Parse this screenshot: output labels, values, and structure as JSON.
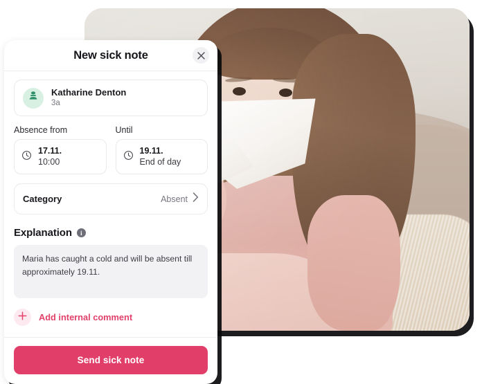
{
  "photo": {
    "alt_description": "Young girl with long brown hair holding a white tissue to her nose, sitting on a beige sofa with a fluffy rug",
    "name": "sick-child-photo"
  },
  "modal": {
    "title": "New sick note",
    "close_label": "×",
    "close_icon": "close-icon",
    "person": {
      "avatar_icon": "person-avatar-icon",
      "name": "Katharine Denton",
      "group": "3a"
    },
    "absence_from": {
      "label": "Absence from",
      "icon": "clock-icon",
      "date": "17.11.",
      "time": "10:00"
    },
    "until": {
      "label": "Until",
      "icon": "clock-icon",
      "date": "19.11.",
      "time": "End of day"
    },
    "category": {
      "label": "Category",
      "value": "Absent",
      "chevron_icon": "chevron-right-icon"
    },
    "explanation": {
      "title": "Explanation",
      "info_icon": "info-icon",
      "info_glyph": "i",
      "text": "Maria has caught a cold and will be absent till approximately 19.11."
    },
    "add_comment": {
      "label": "Add internal comment",
      "icon": "plus-icon"
    },
    "submit": {
      "label": "Send sick note"
    }
  },
  "colors": {
    "accent_pink": "#e23e6a",
    "accent_pink_soft": "#fdeaf0",
    "avatar_green_bg": "#d8f0e2",
    "avatar_green_fg": "#2f9168",
    "text_primary": "#17171c",
    "text_muted": "#77777f",
    "field_bg": "#f2f2f4",
    "border": "#e9e9ec",
    "shadow": "#0a0a0c"
  }
}
